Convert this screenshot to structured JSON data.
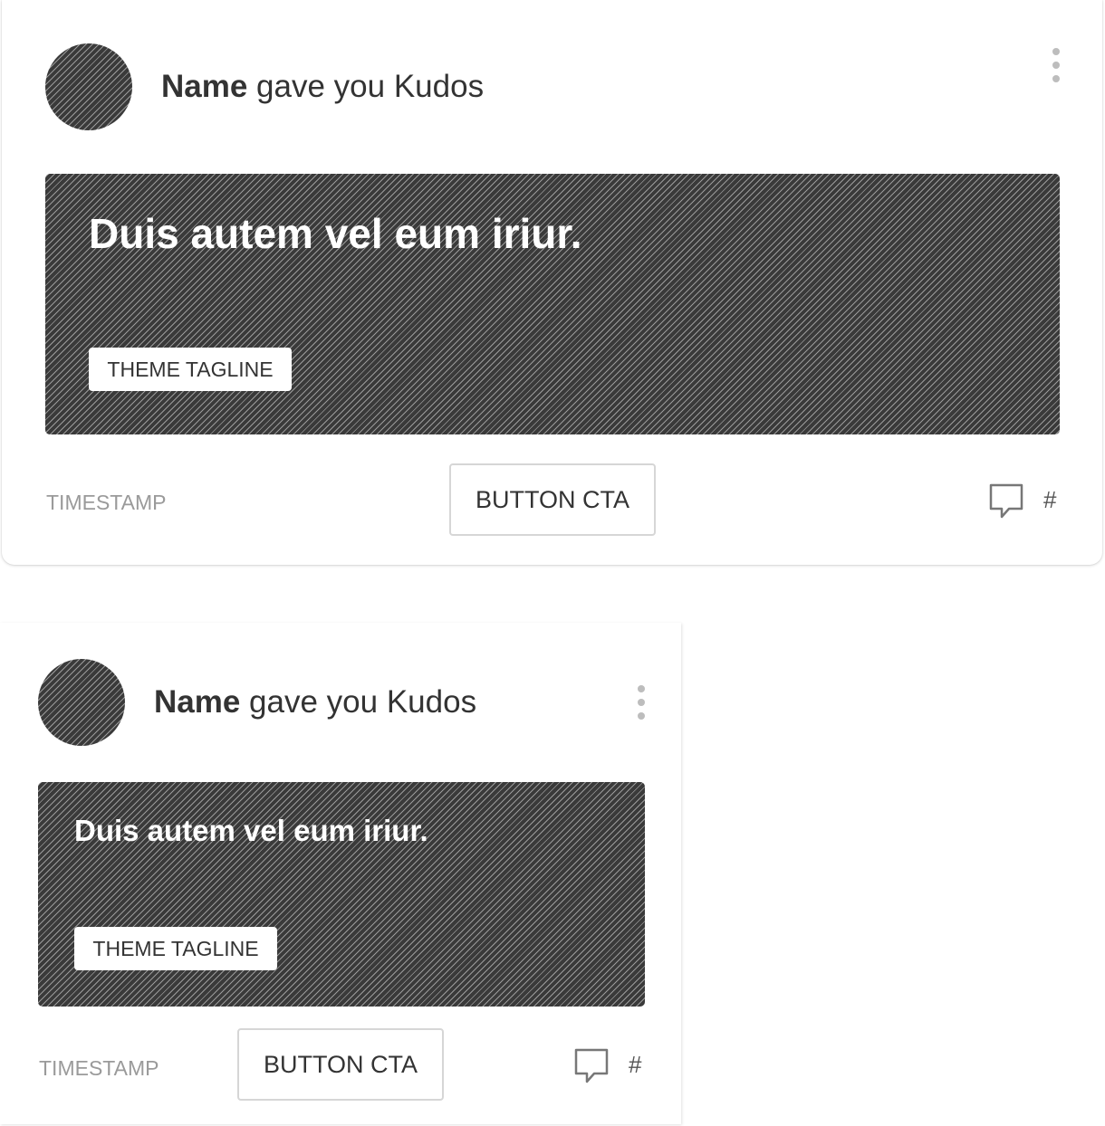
{
  "cards": [
    {
      "sender_name": "Name",
      "action_text": " gave you Kudos",
      "banner_title": "Duis autem vel eum iriur.",
      "theme_tagline": "THEME TAGLINE",
      "timestamp": "TIMESTAMP",
      "button_cta": "BUTTON CTA",
      "comment_count": "#"
    },
    {
      "sender_name": "Name",
      "action_text": " gave you Kudos",
      "banner_title": "Duis autem vel eum iriur.",
      "theme_tagline": "THEME TAGLINE",
      "timestamp": "TIMESTAMP",
      "button_cta": "BUTTON CTA",
      "comment_count": "#"
    }
  ],
  "icons": {
    "more": "vertical-ellipsis-icon",
    "comment": "speech-bubble-icon"
  },
  "colors": {
    "text": "#333333",
    "muted": "#9a9a9a",
    "banner": "#2f2f2f",
    "border": "#d6d6d6",
    "kebab_dot": "#bdbdbd"
  }
}
